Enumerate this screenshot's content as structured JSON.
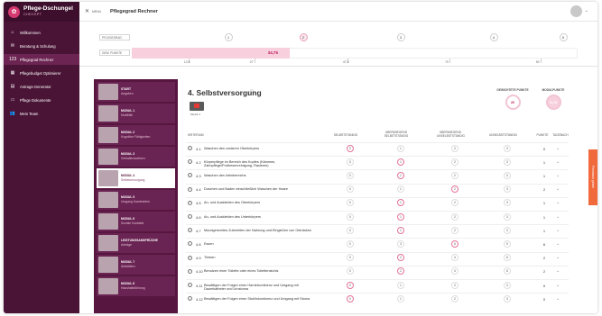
{
  "app": {
    "brand_title": "Pflege-Dschungel",
    "brand_sub": "CHECKPT"
  },
  "sidebar": {
    "items": [
      {
        "label": "Willkommen",
        "icon": "home-icon",
        "glyph": "⌂"
      },
      {
        "label": "Beratung & Schulung",
        "icon": "chat-icon",
        "glyph": "✉"
      },
      {
        "label": "Pflegegrad Rechner",
        "icon": "calculator-icon",
        "glyph": "123",
        "active": true
      },
      {
        "label": "Pflegebudget Optimierer",
        "icon": "grid-icon",
        "glyph": "▦"
      },
      {
        "label": "Antrags-Generator",
        "icon": "document-icon",
        "glyph": "▤"
      },
      {
        "label": "Pflege Dokumente",
        "icon": "file-icon",
        "glyph": "▭"
      },
      {
        "label": "Mein Team",
        "icon": "team-icon",
        "glyph": "👥"
      }
    ]
  },
  "topbar": {
    "menu_label": "MENU",
    "title": "Pflegegrad Rechner"
  },
  "scale": {
    "pflegegrad_label": "PFLEGEGRAD",
    "points_label": "GEW. PUNKTE",
    "grades": [
      "1",
      "2",
      "3",
      "4",
      "5"
    ],
    "active_grade": "2",
    "score": "34,75",
    "score_value": 34.75,
    "ticks": [
      "12,5",
      "27",
      "47,5",
      "70",
      "90"
    ],
    "tick_values": [
      12.5,
      27,
      47.5,
      70,
      90
    ],
    "max": 100
  },
  "modules": [
    {
      "title": "START",
      "sub": "Angaben"
    },
    {
      "title": "MODUL 1",
      "sub": "Mobilität"
    },
    {
      "title": "MODUL 2",
      "sub": "Kognitive Fähigkeiten"
    },
    {
      "title": "MODUL 3",
      "sub": "Verhaltensweisen"
    },
    {
      "title": "MODUL 4",
      "sub": "Selbstversorgung",
      "active": true
    },
    {
      "title": "MODUL 5",
      "sub": "Umgang Krankheiten"
    },
    {
      "title": "MODUL 6",
      "sub": "Soziale Kontakte"
    },
    {
      "title": "LEISTUNGSANSPRÜCHE",
      "sub": "Anträge"
    },
    {
      "title": "MODUL 7",
      "sub": "Aktivitäten"
    },
    {
      "title": "MODUL 8",
      "sub": "Haushaltsführung"
    }
  ],
  "content": {
    "title": "4. Selbstversorgung",
    "video_label": "Modul 4",
    "weighted_points_label": "GEWICHTETE PUNKTE",
    "weighted_points_value": "20",
    "module_points_label": "MODULPUNKTE",
    "module_points_value": "11,25",
    "columns": {
      "kriterium": "KRITERIUM",
      "selbststaendig": "SELBSTSTÄNDIG",
      "ueberwiegend_selbst": "ÜBERWIEGEND SELBSTSTÄNDIG",
      "ueberwiegend_unselbst": "ÜBERWIEGEND UNSELBSTSTÄNDIG",
      "unselbststaendig": "UNSELBSTSTÄNDIG",
      "punkte": "PUNKTE",
      "tagebuch": "TAGEBUCH"
    },
    "rows": [
      {
        "num": "4.1",
        "label": "Waschen des vorderen Oberkörpers",
        "vals": [
          "0",
          "1",
          "2",
          "3"
        ],
        "sel": 0,
        "pts": "0"
      },
      {
        "num": "4.2",
        "label": "Körperpflege im Bereich des Kopfes (Kämmen, Zahnpflege/Prothesenreinigung, Rasieren)",
        "vals": [
          "0",
          "1",
          "2",
          "3"
        ],
        "sel": 1,
        "pts": "1"
      },
      {
        "num": "4.3",
        "label": "Waschen des Intimbereichs",
        "vals": [
          "0",
          "1",
          "2",
          "3"
        ],
        "sel": 1,
        "pts": "1"
      },
      {
        "num": "4.4",
        "label": "Duschen und Baden einschließlich Waschen der Haare",
        "vals": [
          "0",
          "1",
          "2",
          "3"
        ],
        "sel": 2,
        "pts": "2"
      },
      {
        "num": "4.5",
        "label": "An- und Auskleiden des Oberkörpers",
        "vals": [
          "0",
          "1",
          "2",
          "3"
        ],
        "sel": 1,
        "pts": "1"
      },
      {
        "num": "4.6",
        "label": "An- und Auskleiden des Unterkörpers",
        "vals": [
          "0",
          "1",
          "2",
          "3"
        ],
        "sel": 1,
        "pts": "1"
      },
      {
        "num": "4.7",
        "label": "Mundgerechtes Zubereiten der Nahrung und Eingießen von Getränken",
        "vals": [
          "0",
          "1",
          "2",
          "3"
        ],
        "sel": 1,
        "pts": "1"
      },
      {
        "num": "4.8",
        "label": "Essen",
        "vals": [
          "0",
          "3",
          "6",
          "9"
        ],
        "sel": 2,
        "pts": "6"
      },
      {
        "num": "4.9",
        "label": "Trinken",
        "vals": [
          "0",
          "2",
          "4",
          "6"
        ],
        "sel": 1,
        "pts": "2"
      },
      {
        "num": "4.10",
        "label": "Benutzen einer Toilette oder eines Toilettenstuhls",
        "vals": [
          "0",
          "2",
          "4",
          "6"
        ],
        "sel": 1,
        "pts": "2"
      },
      {
        "num": "4.11",
        "label": "Bewältigen der Folgen einer Harninkontinenz und Umgang mit Dauerkatheter und Urostoma",
        "vals": [
          "0",
          "1",
          "2",
          "3"
        ],
        "sel": 0,
        "pts": "0"
      },
      {
        "num": "4.12",
        "label": "Bewältigen der Folgen einer Stuhlinkontinenz und Umgang mit Stoma",
        "vals": [
          "0",
          "1",
          "2",
          "3"
        ],
        "sel": 0,
        "pts": "0"
      }
    ]
  },
  "feedback_label": "Feedback geben",
  "colors": {
    "brand": "#4a1436",
    "accent": "#c2185b",
    "highlight": "#f7cfdd"
  }
}
